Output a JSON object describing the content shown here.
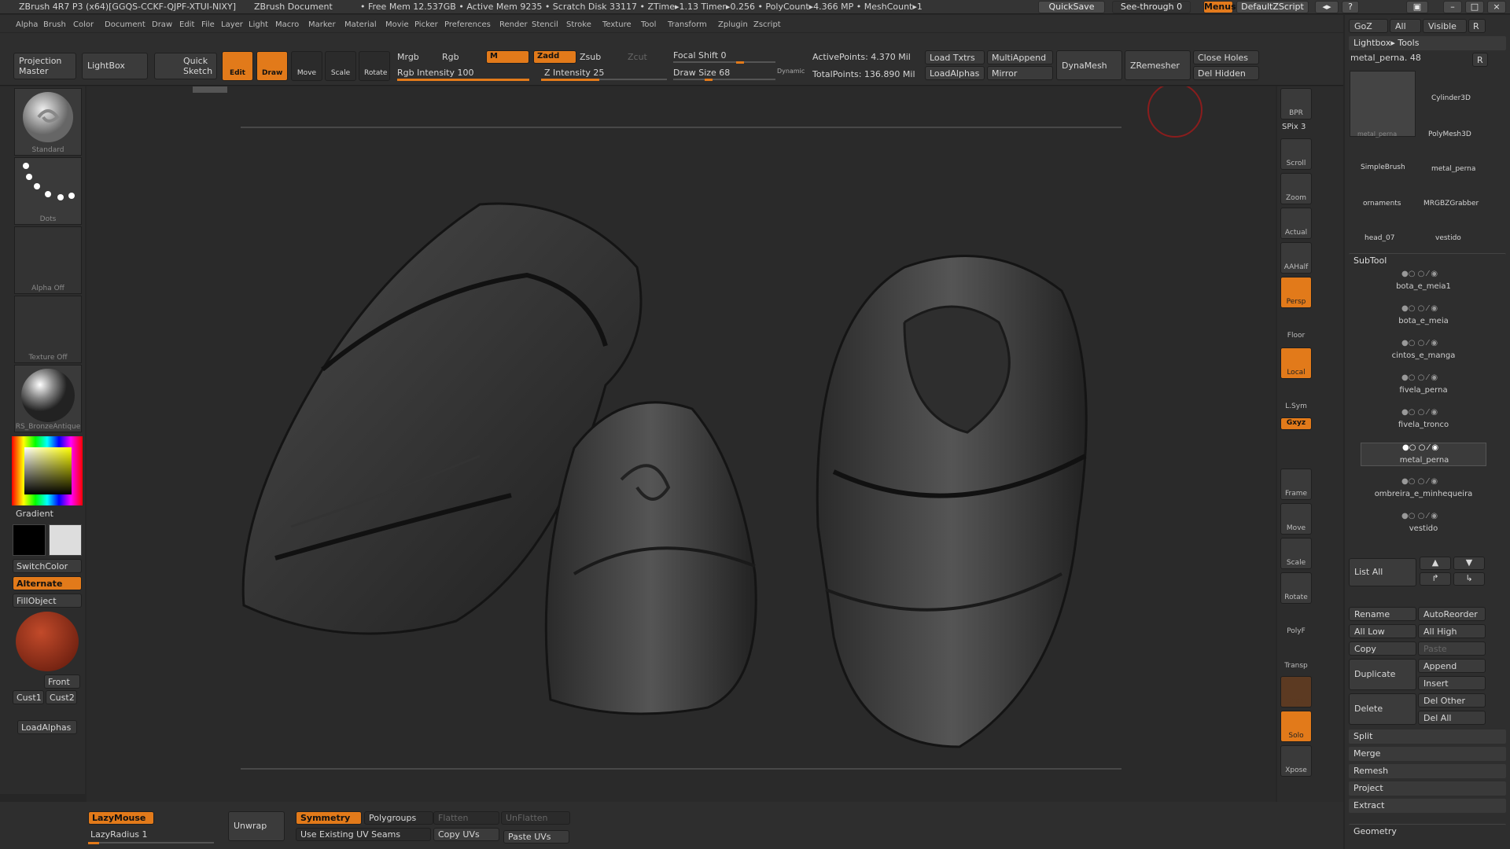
{
  "titlebar": {
    "app": "ZBrush 4R7 P3 (x64)[GGQS-CCKF-QJPF-XTUI-NIXY]",
    "doc": "ZBrush Document",
    "mem": "• Free Mem 12.537GB • Active Mem 9235 • Scratch Disk 33117 • ZTime▸1.13 Timer▸0.256 • PolyCount▸4.366 MP • MeshCount▸1",
    "quicksave": "QuickSave",
    "seethrough": "See-through  0",
    "menus": "Menus",
    "script": "DefaultZScript"
  },
  "menu": [
    "Alpha",
    "Brush",
    "Color",
    "Document",
    "Draw",
    "Edit",
    "File",
    "Layer",
    "Light",
    "Macro",
    "Marker",
    "Material",
    "Movie",
    "Picker",
    "Preferences",
    "Render",
    "Stencil",
    "Stroke",
    "Texture",
    "Tool",
    "Transform",
    "Zplugin",
    "Zscript"
  ],
  "shelf": {
    "projection": "Projection Master",
    "lightbox": "LightBox",
    "quicksketch": "Quick Sketch",
    "edit": "Edit",
    "draw": "Draw",
    "move": "Move",
    "scale": "Scale",
    "rotate": "Rotate",
    "mrgb": "Mrgb",
    "rgb": "Rgb",
    "m": "M",
    "zadd": "Zadd",
    "zsub": "Zsub",
    "zcut": "Zcut",
    "rgb_intensity": "Rgb Intensity 100",
    "z_intensity": "Z Intensity 25",
    "focal_shift": "Focal Shift 0",
    "draw_size": "Draw Size 68",
    "dynamic": "Dynamic",
    "active_points": "ActivePoints: 4.370 Mil",
    "total_points": "TotalPoints: 136.890 Mil",
    "load_txtrs": "Load Txtrs",
    "load_alphas": "LoadAlphas",
    "multiappend": "MultiAppend",
    "mirror": "Mirror",
    "dynamesh": "DynaMesh",
    "zremesher": "ZRemesher",
    "close_holes": "Close Holes",
    "del_hidden": "Del Hidden"
  },
  "left": {
    "brush": "Standard",
    "stroke": "Dots",
    "alpha": "Alpha Off",
    "texture": "Texture Off",
    "material": "RS_BronzeAntique",
    "gradient": "Gradient",
    "switchcolor": "SwitchColor",
    "alternate": "Alternate",
    "fillobject": "FillObject",
    "front": "Front",
    "cust1": "Cust1",
    "cust2": "Cust2",
    "loadalphas": "LoadAlphas"
  },
  "right": {
    "bpr": "BPR",
    "spix": "SPix 3",
    "scroll": "Scroll",
    "zoom": "Zoom",
    "actual": "Actual",
    "aahalf": "AAHalf",
    "persp": "Persp",
    "floor": "Floor",
    "local": "Local",
    "lsym": "L.Sym",
    "xyz": "Gxyz",
    "frame": "Frame",
    "move": "Move",
    "scale": "Scale",
    "rotate": "Rotate",
    "polyf": "PolyF",
    "transp": "Transp",
    "ghost": "Ghost",
    "solo": "Solo",
    "xpose": "Xpose"
  },
  "panel": {
    "goz": "GoZ",
    "all": "All",
    "visible": "Visible",
    "r": "R",
    "lightbox_tools": "Lightbox▸ Tools",
    "tool_name": "metal_perna. 48",
    "tools": [
      "metal_perna",
      "Cylinder3D",
      "PolyMesh3D",
      "SimpleBrush",
      "metal_perna",
      "ornaments",
      "MRGBZGrabber",
      "head_07",
      "vestido"
    ],
    "subtool": "SubTool",
    "subtools": [
      "bota_e_meia1",
      "bota_e_meia",
      "cintos_e_manga",
      "fivela_perna",
      "fivela_tronco",
      "metal_perna",
      "ombreira_e_minhequeira",
      "vestido"
    ],
    "list_all": "List All",
    "rename": "Rename",
    "autoreorder": "AutoReorder",
    "all_low": "All Low",
    "all_high": "All High",
    "copy": "Copy",
    "paste": "Paste",
    "duplicate": "Duplicate",
    "append": "Append",
    "insert": "Insert",
    "delete": "Delete",
    "del_other": "Del Other",
    "del_all": "Del All",
    "split": "Split",
    "merge": "Merge",
    "remesh": "Remesh",
    "project": "Project",
    "extract": "Extract",
    "geometry": "Geometry"
  },
  "bottom": {
    "lazymouse": "LazyMouse",
    "lazyradius": "LazyRadius 1",
    "unwrap": "Unwrap",
    "symmetry": "Symmetry",
    "polygroups": "Polygroups",
    "flatten": "Flatten",
    "unflatten": "UnFlatten",
    "use_existing": "Use Existing UV Seams",
    "copy_uvs": "Copy UVs",
    "paste_uvs": "Paste UVs"
  },
  "colors": {
    "accent": "#e27a1a",
    "bg": "#262626"
  }
}
